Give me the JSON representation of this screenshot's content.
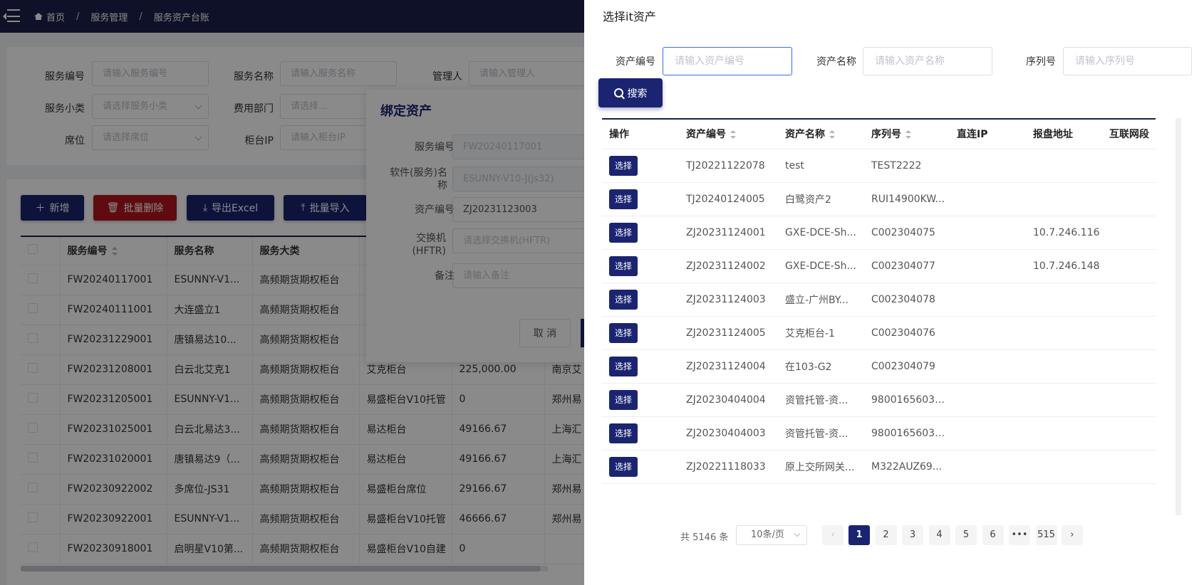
{
  "breadcrumb": [
    "首页",
    "服务管理",
    "服务资产台账"
  ],
  "filters": {
    "service_no": {
      "label": "服务编号",
      "placeholder": "请输入服务编号"
    },
    "service_name": {
      "label": "服务名称",
      "placeholder": "请输入服务名称"
    },
    "manager": {
      "label": "管理人",
      "placeholder": "请输入管理人"
    },
    "sub_category": {
      "label": "服务小类",
      "placeholder": "请选择服务小类"
    },
    "cost_dept": {
      "label": "费用部门",
      "placeholder": "请选择..."
    },
    "seat": {
      "label": "席位",
      "placeholder": "请选择席位"
    },
    "counter_ip": {
      "label": "柜台IP",
      "placeholder": "请输入柜台IP"
    }
  },
  "toolbar": {
    "add": "新增",
    "batch_delete": "批量删除",
    "export": "导出Excel",
    "import": "批量导入"
  },
  "main_table": {
    "headers": [
      "服务编号",
      "服务名称",
      "服务大类"
    ],
    "rows": [
      {
        "no": "FW20240117001",
        "name": "ESUNNY-V1...",
        "category": "高频期货期权柜台",
        "type": "",
        "amount": "",
        "city": ""
      },
      {
        "no": "FW20240111001",
        "name": "大连盛立1",
        "category": "高频期货期权柜台",
        "type": "",
        "amount": "",
        "city": ""
      },
      {
        "no": "FW20231229001",
        "name": "唐镇易达10...",
        "category": "高频期货期权柜台",
        "type": "",
        "amount": "",
        "city": ""
      },
      {
        "no": "FW20231208001",
        "name": "白云北艾克1",
        "category": "高频期货期权柜台",
        "type": "艾克柜台",
        "amount": "225,000.00",
        "city": "南京艾"
      },
      {
        "no": "FW20231205001",
        "name": "ESUNNY-V1...",
        "category": "高频期货期权柜台",
        "type": "易盛柜台V10托管",
        "amount": "0",
        "city": "郑州易"
      },
      {
        "no": "FW20231025001",
        "name": "白云北易达3...",
        "category": "高频期货期权柜台",
        "type": "易达柜台",
        "amount": "49166.67",
        "city": "上海汇"
      },
      {
        "no": "FW20231020001",
        "name": "唐镇易达9（...",
        "category": "高频期货期权柜台",
        "type": "易达柜台",
        "amount": "49166.67",
        "city": "上海汇"
      },
      {
        "no": "FW20230922002",
        "name": "多席位-JS31",
        "category": "高频期货期权柜台",
        "type": "易盛柜台席位",
        "amount": "29166.67",
        "city": "郑州易"
      },
      {
        "no": "FW20230922001",
        "name": "ESUNNY-V1...",
        "category": "高频期货期权柜台",
        "type": "易盛柜台V10托管",
        "amount": "46666.67",
        "city": "郑州易"
      },
      {
        "no": "FW20230918001",
        "name": "启明星V10第...",
        "category": "高频期货期权柜台",
        "type": "易盛柜台V10自建",
        "amount": "0",
        "city": ""
      }
    ]
  },
  "bind_dialog": {
    "title": "绑定资产",
    "service_no_label": "服务编号",
    "service_no_value": "FW20240117001",
    "software_label": "软件(服务)名称",
    "software_value": "ESUNNY-V10-J(js32)",
    "asset_no_label": "资产编号",
    "asset_no_value": "ZJ20231123003",
    "switch_label": "交换机(HFTR)",
    "switch_placeholder": "请选择交换机(HFTR)",
    "remark_label": "备注",
    "remark_placeholder": "请输入备注",
    "cancel": "取 消"
  },
  "drawer": {
    "title": "选择it资产",
    "asset_no_label": "资产编号",
    "asset_no_placeholder": "请输入资产编号",
    "asset_name_label": "资产名称",
    "asset_name_placeholder": "请输入资产名称",
    "serial_label": "序列号",
    "serial_placeholder": "请输入序列号",
    "search": "搜索",
    "headers": [
      "操作",
      "资产编号",
      "资产名称",
      "序列号",
      "直连IP",
      "报盘地址",
      "互联网段"
    ],
    "select_label": "选择",
    "rows": [
      {
        "asset_no": "TJ20221122078",
        "name": "test",
        "serial": "TEST2222",
        "ip": "",
        "addr": "",
        "segment": ""
      },
      {
        "asset_no": "TJ20240124005",
        "name": "白鹭资产2",
        "serial": "RUI14900KW...",
        "ip": "",
        "addr": "",
        "segment": ""
      },
      {
        "asset_no": "ZJ20231124001",
        "name": "GXE-DCE-Sh...",
        "serial": "C002304075",
        "ip": "",
        "addr": "10.7.246.116",
        "segment": ""
      },
      {
        "asset_no": "ZJ20231124002",
        "name": "GXE-DCE-Sh...",
        "serial": "C002304077",
        "ip": "",
        "addr": "10.7.246.148",
        "segment": ""
      },
      {
        "asset_no": "ZJ20231124003",
        "name": "盛立-广州BY...",
        "serial": "C002304078",
        "ip": "",
        "addr": "",
        "segment": ""
      },
      {
        "asset_no": "ZJ20231124005",
        "name": "艾克柜台-1",
        "serial": "C002304076",
        "ip": "",
        "addr": "",
        "segment": ""
      },
      {
        "asset_no": "ZJ20231124004",
        "name": "在103-G2",
        "serial": "C002304079",
        "ip": "",
        "addr": "",
        "segment": ""
      },
      {
        "asset_no": "ZJ20230404004",
        "name": "资管托管-资...",
        "serial": "98001656036...",
        "ip": "",
        "addr": "",
        "segment": ""
      },
      {
        "asset_no": "ZJ20230404003",
        "name": "资管托管-资...",
        "serial": "98001656036...",
        "ip": "",
        "addr": "",
        "segment": ""
      },
      {
        "asset_no": "ZJ20221118033",
        "name": "原上交所网关...",
        "serial": "M322AUZ69...",
        "ip": "",
        "addr": "",
        "segment": ""
      }
    ],
    "pagination": {
      "total": "共 5146 条",
      "page_size": "10条/页",
      "pages": [
        "1",
        "2",
        "3",
        "4",
        "5",
        "6",
        "•••",
        "515"
      ],
      "current": "1"
    }
  }
}
